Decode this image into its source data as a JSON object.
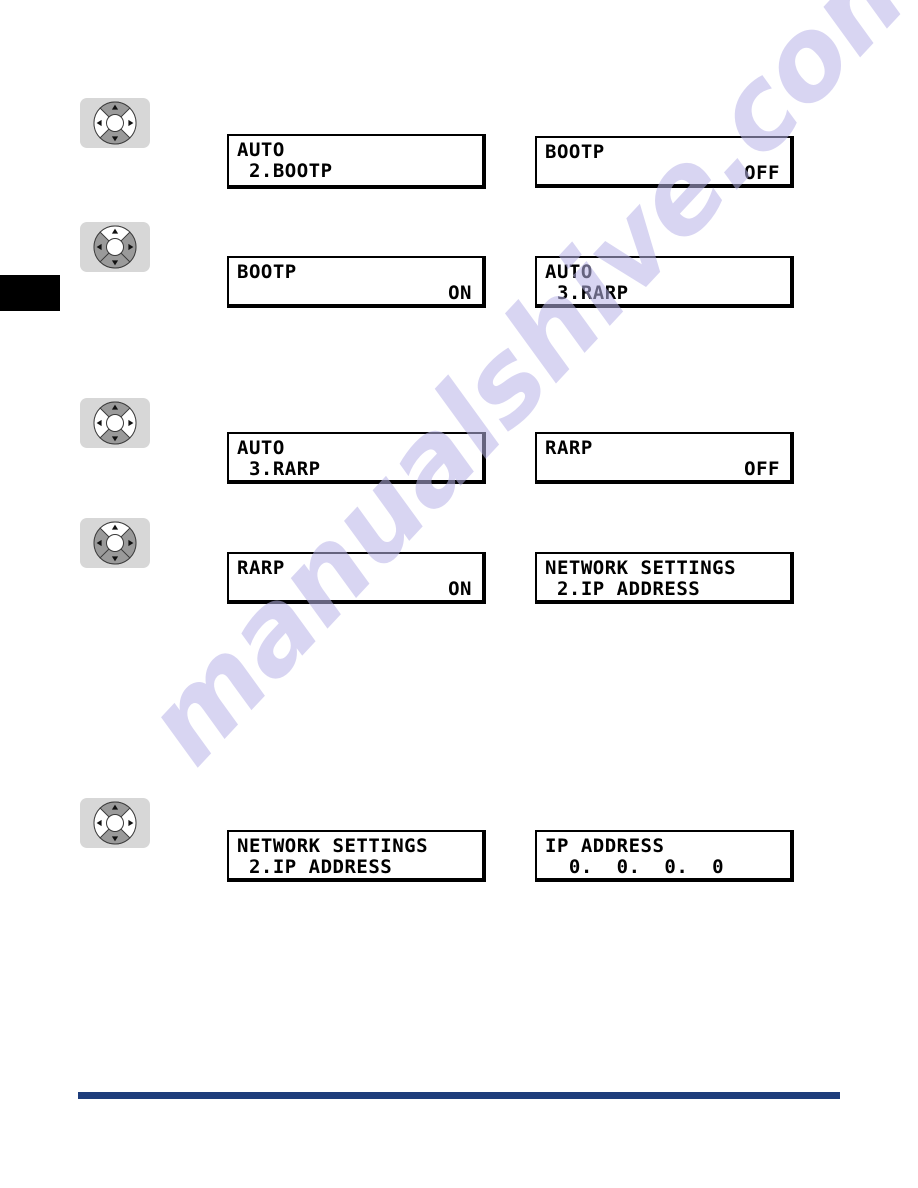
{
  "page": {
    "watermark_text": "manualshive.com",
    "accent_color": "#1e3d7b",
    "edge_tab_color": "#000000",
    "navpad_bg_color": "#d7d7d7",
    "navpad_ring_color": "#9a9a9a"
  },
  "steps": [
    {
      "navpad": {
        "name": "navigation-pad",
        "highlight": "vertical",
        "arrows": {
          "up": "▲",
          "down": "▼",
          "left": "◀",
          "right": "▶"
        }
      },
      "left_display": {
        "name": "lcd-auto-bootp",
        "line1": "AUTO",
        "line2": " 2.BOOTP",
        "line2_align": "left"
      },
      "right_display": {
        "name": "lcd-bootp-off",
        "line1": "BOOTP",
        "line2": "OFF",
        "line2_align": "right"
      }
    },
    {
      "navpad": {
        "name": "navigation-pad",
        "highlight": "right",
        "arrows": {
          "up": "▲",
          "down": "▼",
          "left": "◀",
          "right": "▶"
        }
      },
      "left_display": {
        "name": "lcd-bootp-on",
        "line1": "BOOTP",
        "line2": "ON",
        "line2_align": "right"
      },
      "right_display": {
        "name": "lcd-auto-rarp",
        "line1": "AUTO",
        "line2": " 3.RARP",
        "line2_align": "left"
      }
    },
    {
      "navpad": {
        "name": "navigation-pad",
        "highlight": "vertical",
        "arrows": {
          "up": "▲",
          "down": "▼",
          "left": "◀",
          "right": "▶"
        }
      },
      "left_display": {
        "name": "lcd-auto-rarp-2",
        "line1": "AUTO",
        "line2": " 3.RARP",
        "line2_align": "left"
      },
      "right_display": {
        "name": "lcd-rarp-off",
        "line1": "RARP",
        "line2": "OFF",
        "line2_align": "right"
      }
    },
    {
      "navpad": {
        "name": "navigation-pad",
        "highlight": "right",
        "arrows": {
          "up": "▲",
          "down": "▼",
          "left": "◀",
          "right": "▶"
        }
      },
      "left_display": {
        "name": "lcd-rarp-on",
        "line1": "RARP",
        "line2": "ON",
        "line2_align": "right"
      },
      "right_display": {
        "name": "lcd-network-settings-ip-address",
        "line1": "NETWORK SETTINGS",
        "line2": " 2.IP ADDRESS",
        "line2_align": "left"
      }
    },
    {
      "navpad": {
        "name": "navigation-pad",
        "highlight": "vertical",
        "arrows": {
          "up": "▲",
          "down": "▼",
          "left": "◀",
          "right": "▶"
        }
      },
      "left_display": {
        "name": "lcd-network-settings-ip-address-2",
        "line1": "NETWORK SETTINGS",
        "line2": " 2.IP ADDRESS",
        "line2_align": "left"
      },
      "right_display": {
        "name": "lcd-ip-address-value",
        "line1": "IP ADDRESS",
        "line2": "  0.  0.  0.  0",
        "line2_align": "left"
      }
    }
  ]
}
